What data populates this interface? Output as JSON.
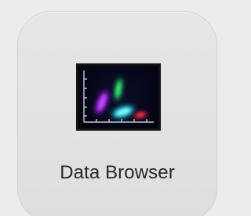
{
  "launcher": {
    "tile": {
      "label": "Data Browser",
      "icon": "scatter-plot-icon"
    }
  },
  "colors": {
    "page_background": "#ececec",
    "tile_background": "#e3e3e3",
    "tile_border": "#d2d2d2",
    "icon_background": "#06061a",
    "icon_frame": "#141414",
    "cluster_magenta": "#b23cf0",
    "cluster_green": "#2fd66a",
    "cluster_cyan": "#35e6ee",
    "cluster_red": "#e2284a",
    "label_text": "#262626"
  }
}
